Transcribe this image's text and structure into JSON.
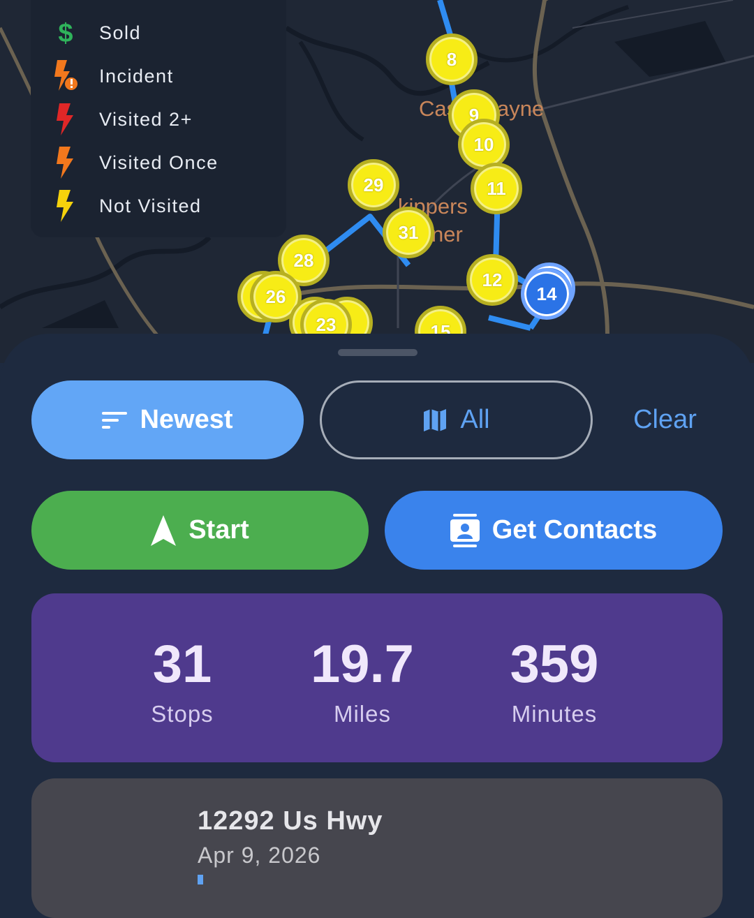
{
  "legend": {
    "items": [
      {
        "label": "Sold",
        "icon": "dollar-icon",
        "color": "#2fb35b"
      },
      {
        "label": "Incident",
        "icon": "bolt-incident-icon",
        "color": "#f2781d"
      },
      {
        "label": "Visited 2+",
        "icon": "bolt-icon",
        "color": "#e02727"
      },
      {
        "label": "Visited Once",
        "icon": "bolt-icon",
        "color": "#f2781d"
      },
      {
        "label": "Not Visited",
        "icon": "bolt-icon",
        "color": "#f5d20c"
      }
    ]
  },
  "map": {
    "place_labels": [
      "Cas",
      "ayne",
      "kippers",
      "ner"
    ],
    "markers": [
      "8",
      "9",
      "10",
      "11",
      "29",
      "31",
      "28",
      "12",
      "14",
      "26",
      "23",
      "15"
    ]
  },
  "controls": {
    "sort_label": "Newest",
    "filter_label": "All",
    "clear_label": "Clear",
    "start_label": "Start",
    "contacts_label": "Get Contacts"
  },
  "stats": {
    "stops_value": "31",
    "stops_label": "Stops",
    "miles_value": "19.7",
    "miles_label": "Miles",
    "minutes_value": "359",
    "minutes_label": "Minutes"
  },
  "card": {
    "address": "12292 Us Hwy",
    "date": "Apr 9, 2026"
  },
  "colors": {
    "accent_blue": "#3a83ec",
    "start_green": "#4cae4f",
    "stats_purple": "#4f3a8d",
    "marker_yellow": "#f7ec16"
  }
}
